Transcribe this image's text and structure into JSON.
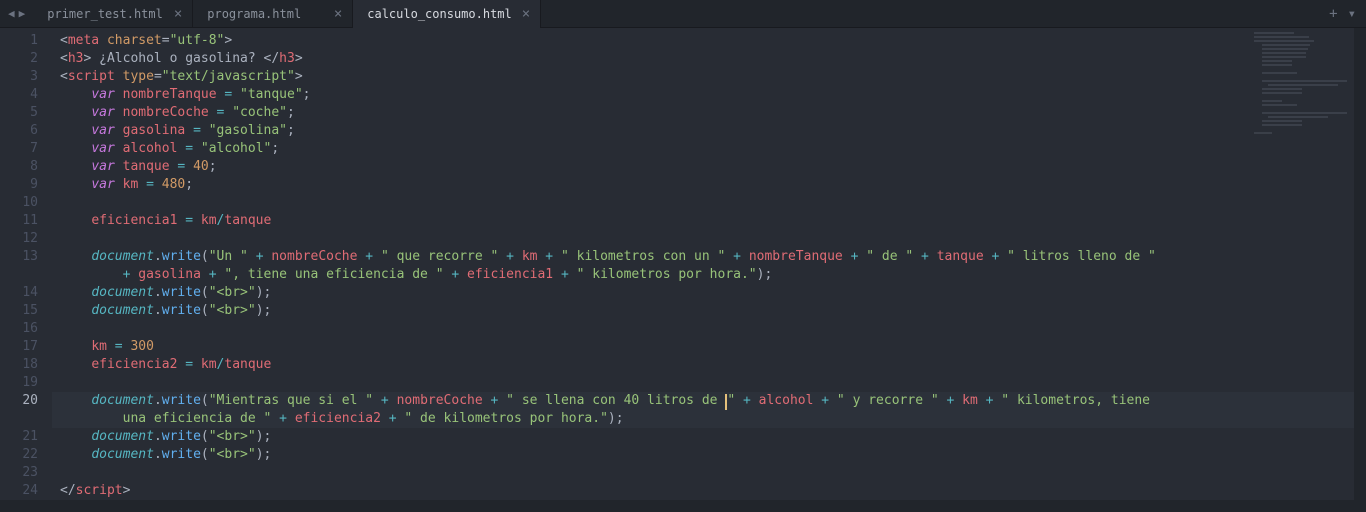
{
  "tabs": [
    {
      "label": "primer_test.html",
      "active": false
    },
    {
      "label": "programa.html",
      "active": false
    },
    {
      "label": "calculo_consumo.html",
      "active": true
    }
  ],
  "tabbar": {
    "plus": "+",
    "menu": "▾"
  },
  "gutter": {
    "numbers": [
      "1",
      "2",
      "3",
      "4",
      "5",
      "6",
      "7",
      "8",
      "9",
      "10",
      "11",
      "12",
      "13",
      "",
      "14",
      "15",
      "16",
      "17",
      "18",
      "19",
      "20",
      "",
      "21",
      "22",
      "23",
      "24"
    ],
    "currentLine": 20
  },
  "code": {
    "l1": {
      "open": "<",
      "tag": "meta",
      "attr": " charset",
      "eq": "=",
      "val": "\"utf-8\"",
      "close": ">"
    },
    "l2": {
      "open": "<",
      "tag": "h3",
      "close1": ">",
      "text": " ¿Alcohol o gasolina? ",
      "open2": "</",
      "tag2": "h3",
      "close2": ">"
    },
    "l3": {
      "open": "<",
      "tag": "script",
      "attr": " type",
      "eq": "=",
      "val": "\"text/javascript\"",
      "close": ">"
    },
    "l4": {
      "ind": "    ",
      "kw": "var",
      "sp": " ",
      "id": "nombreTanque",
      "op": " = ",
      "str": "\"tanque\"",
      "semi": ";"
    },
    "l5": {
      "ind": "    ",
      "kw": "var",
      "sp": " ",
      "id": "nombreCoche",
      "op": " = ",
      "str": "\"coche\"",
      "semi": ";"
    },
    "l6": {
      "ind": "    ",
      "kw": "var",
      "sp": " ",
      "id": "gasolina",
      "op": " = ",
      "str": "\"gasolina\"",
      "semi": ";"
    },
    "l7": {
      "ind": "    ",
      "kw": "var",
      "sp": " ",
      "id": "alcohol",
      "op": " = ",
      "str": "\"alcohol\"",
      "semi": ";"
    },
    "l8": {
      "ind": "    ",
      "kw": "var",
      "sp": " ",
      "id": "tanque",
      "op": " = ",
      "num": "40",
      "semi": ";"
    },
    "l9": {
      "ind": "    ",
      "kw": "var",
      "sp": " ",
      "id": "km",
      "op": " = ",
      "num": "480",
      "semi": ";"
    },
    "l11": {
      "ind": "    ",
      "id1": "eficiencia1",
      "op1": " = ",
      "id2": "km",
      "op2": "/",
      "id3": "tanque"
    },
    "l13": {
      "ind": "    ",
      "obj": "document",
      "dot": ".",
      "fn": "write",
      "open": "(",
      "s1": "\"Un \"",
      "p1": " + ",
      "v1": "nombreCoche",
      "p2": " + ",
      "s2": "\" que recorre \"",
      "p3": " + ",
      "v2": "km",
      "p4": " + ",
      "s3": "\" kilometros con un \"",
      "p5": " + ",
      "v3": "nombreTanque",
      "p6": " + ",
      "s4": "\" de \"",
      "p7": " + ",
      "v4": "tanque",
      "p8": " + ",
      "s5": "\" litros lleno de \""
    },
    "l13b": {
      "ind": "        ",
      "p1": "+ ",
      "v1": "gasolina",
      "p2": " + ",
      "s1": "\", tiene una eficiencia de \"",
      "p3": " + ",
      "v2": "eficiencia1",
      "p4": " + ",
      "s2": "\" kilometros por hora.\"",
      "close": ");"
    },
    "l14": {
      "ind": "    ",
      "obj": "document",
      "dot": ".",
      "fn": "write",
      "open": "(",
      "s": "\"<br>\"",
      "close": ");"
    },
    "l15": {
      "ind": "    ",
      "obj": "document",
      "dot": ".",
      "fn": "write",
      "open": "(",
      "s": "\"<br>\"",
      "close": ");"
    },
    "l17": {
      "ind": "    ",
      "id": "km",
      "op": " = ",
      "num": "300"
    },
    "l18": {
      "ind": "    ",
      "id1": "eficiencia2",
      "op1": " = ",
      "id2": "km",
      "op2": "/",
      "id3": "tanque"
    },
    "l20": {
      "ind": "    ",
      "obj": "document",
      "dot": ".",
      "fn": "write",
      "open": "(",
      "s1": "\"Mientras que si el \"",
      "p1": " + ",
      "v1": "nombreCoche",
      "p2": " + ",
      "s2": "\" se llena con 40 litros de ",
      "s2b": "\"",
      "p3": " + ",
      "v2": "alcohol",
      "p4": " + ",
      "s3": "\" y recorre \"",
      "p5": " + ",
      "v3": "km",
      "p6": " + ",
      "s4": "\" kilometros, tiene "
    },
    "l20b": {
      "ind": "        ",
      "s1": "una eficiencia de \"",
      "p1": " + ",
      "v1": "eficiencia2",
      "p2": " + ",
      "s2": "\" de kilometros por hora.\"",
      "close": ");"
    },
    "l21": {
      "ind": "    ",
      "obj": "document",
      "dot": ".",
      "fn": "write",
      "open": "(",
      "s": "\"<br>\"",
      "close": ");"
    },
    "l22": {
      "ind": "    ",
      "obj": "document",
      "dot": ".",
      "fn": "write",
      "open": "(",
      "s": "\"<br>\"",
      "close": ");"
    },
    "l24": {
      "open": "</",
      "tag": "script",
      "close": ">"
    }
  }
}
